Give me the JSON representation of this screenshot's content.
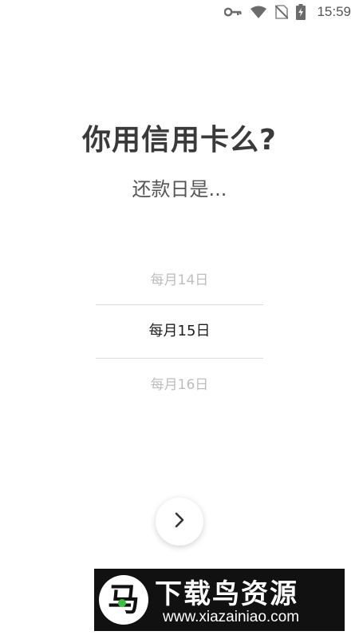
{
  "status_bar": {
    "time": "15:59",
    "icons": [
      "vpn-key-icon",
      "wifi-icon",
      "no-sim-icon",
      "battery-charging-icon"
    ]
  },
  "main": {
    "title": "你用信用卡么?",
    "subtitle": "还款日是...",
    "picker": {
      "previous": "每月14日",
      "selected": "每月15日",
      "next": "每月16日"
    },
    "next_button_icon": "chevron-right-icon"
  },
  "watermark": {
    "logo_glyph": "马",
    "brand": "下载鸟资源",
    "url": "www.xiazainiao.com"
  },
  "colors": {
    "title": "#3a3a3a",
    "selected_option": "#1f1f1f",
    "faded_option": "#bdbdbd",
    "divider": "#dcdcdc",
    "watermark_bg": "#111111",
    "logo_dot": "#3fbf3f"
  }
}
